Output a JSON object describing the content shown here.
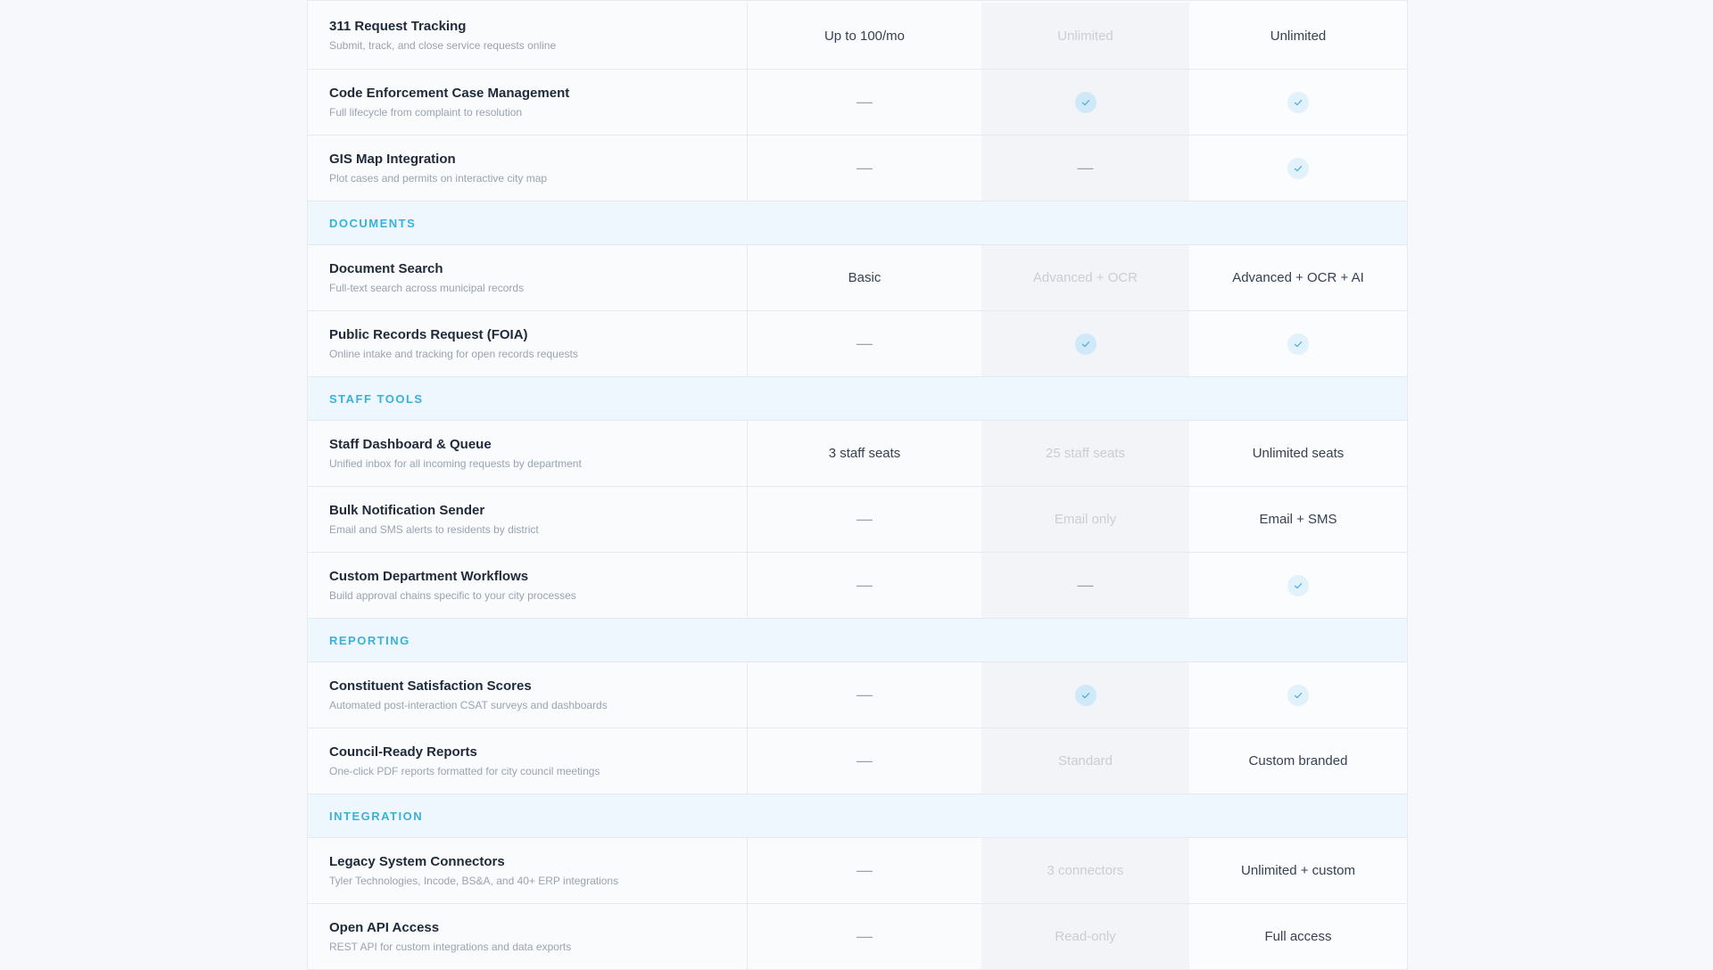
{
  "colors": {
    "accent": "#38b2d8",
    "section_bg": "#eef6fe",
    "check_bg": "#cfe9f8"
  },
  "rows": [
    {
      "type": "feature",
      "name": "311 Request Tracking",
      "desc": "Submit, track, and close service requests online",
      "c1": {
        "kind": "text",
        "value": "Up to 100/mo"
      },
      "c2": {
        "kind": "text",
        "value": "Unlimited"
      },
      "c3": {
        "kind": "text",
        "value": "Unlimited"
      }
    },
    {
      "type": "feature",
      "name": "Code Enforcement Case Management",
      "desc": "Full lifecycle from complaint to resolution",
      "c1": {
        "kind": "dash",
        "value": "—"
      },
      "c2": {
        "kind": "check",
        "value": "check-icon"
      },
      "c3": {
        "kind": "check",
        "value": "check-icon"
      }
    },
    {
      "type": "feature",
      "name": "GIS Map Integration",
      "desc": "Plot cases and permits on interactive city map",
      "c1": {
        "kind": "dash",
        "value": "—"
      },
      "c2": {
        "kind": "dash",
        "value": "—"
      },
      "c3": {
        "kind": "check",
        "value": "check-icon"
      }
    },
    {
      "type": "section",
      "label": "DOCUMENTS"
    },
    {
      "type": "feature",
      "name": "Document Search",
      "desc": "Full-text search across municipal records",
      "c1": {
        "kind": "text",
        "value": "Basic"
      },
      "c2": {
        "kind": "text",
        "value": "Advanced + OCR"
      },
      "c3": {
        "kind": "text",
        "value": "Advanced + OCR + AI"
      }
    },
    {
      "type": "feature",
      "name": "Public Records Request (FOIA)",
      "desc": "Online intake and tracking for open records requests",
      "c1": {
        "kind": "dash",
        "value": "—"
      },
      "c2": {
        "kind": "check",
        "value": "check-icon"
      },
      "c3": {
        "kind": "check",
        "value": "check-icon"
      }
    },
    {
      "type": "section",
      "label": "STAFF TOOLS"
    },
    {
      "type": "feature",
      "name": "Staff Dashboard & Queue",
      "desc": "Unified inbox for all incoming requests by department",
      "c1": {
        "kind": "text",
        "value": "3 staff seats"
      },
      "c2": {
        "kind": "text",
        "value": "25 staff seats"
      },
      "c3": {
        "kind": "text",
        "value": "Unlimited seats"
      }
    },
    {
      "type": "feature",
      "name": "Bulk Notification Sender",
      "desc": "Email and SMS alerts to residents by district",
      "c1": {
        "kind": "dash",
        "value": "—"
      },
      "c2": {
        "kind": "text",
        "value": "Email only"
      },
      "c3": {
        "kind": "text",
        "value": "Email + SMS"
      }
    },
    {
      "type": "feature",
      "name": "Custom Department Workflows",
      "desc": "Build approval chains specific to your city processes",
      "c1": {
        "kind": "dash",
        "value": "—"
      },
      "c2": {
        "kind": "dash",
        "value": "—"
      },
      "c3": {
        "kind": "check",
        "value": "check-icon"
      }
    },
    {
      "type": "section",
      "label": "REPORTING"
    },
    {
      "type": "feature",
      "name": "Constituent Satisfaction Scores",
      "desc": "Automated post-interaction CSAT surveys and dashboards",
      "c1": {
        "kind": "dash",
        "value": "—"
      },
      "c2": {
        "kind": "check",
        "value": "check-icon"
      },
      "c3": {
        "kind": "check",
        "value": "check-icon"
      }
    },
    {
      "type": "feature",
      "name": "Council-Ready Reports",
      "desc": "One-click PDF reports formatted for city council meetings",
      "c1": {
        "kind": "dash",
        "value": "—"
      },
      "c2": {
        "kind": "text",
        "value": "Standard"
      },
      "c3": {
        "kind": "text",
        "value": "Custom branded"
      }
    },
    {
      "type": "section",
      "label": "INTEGRATION"
    },
    {
      "type": "feature",
      "name": "Legacy System Connectors",
      "desc": "Tyler Technologies, Incode, BS&A, and 40+ ERP integrations",
      "c1": {
        "kind": "dash",
        "value": "—"
      },
      "c2": {
        "kind": "text",
        "value": "3 connectors"
      },
      "c3": {
        "kind": "text",
        "value": "Unlimited + custom"
      }
    },
    {
      "type": "feature",
      "name": "Open API Access",
      "desc": "REST API for custom integrations and data exports",
      "c1": {
        "kind": "dash",
        "value": "—"
      },
      "c2": {
        "kind": "text",
        "value": "Read-only"
      },
      "c3": {
        "kind": "text",
        "value": "Full access"
      }
    }
  ]
}
